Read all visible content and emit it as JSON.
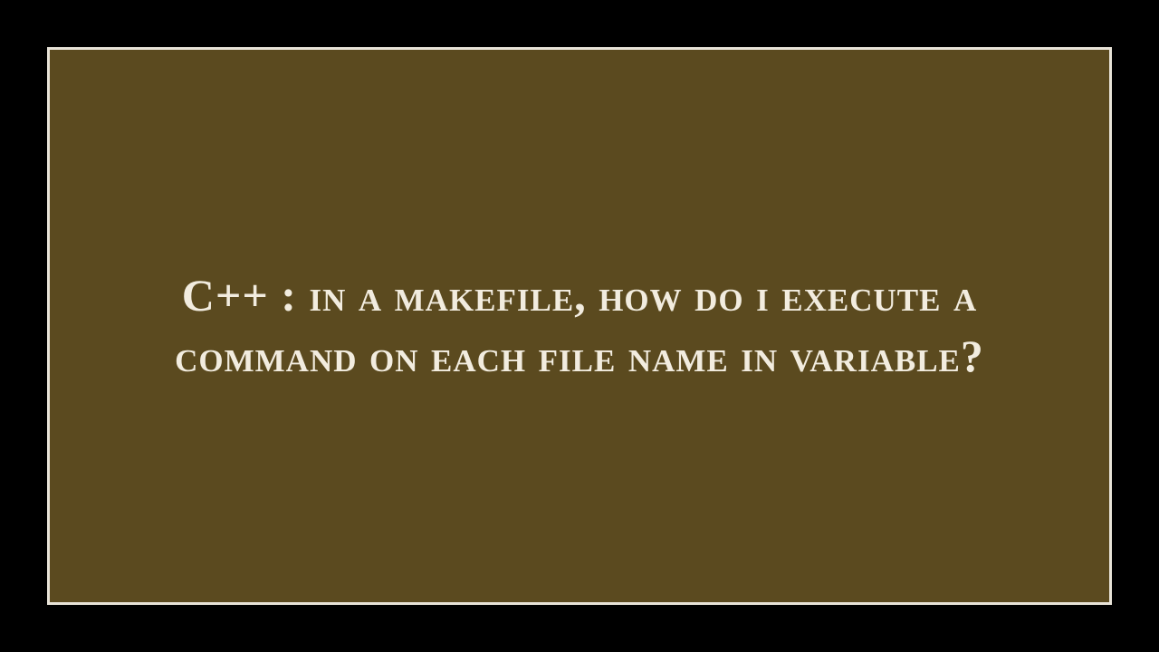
{
  "title": "C++ : In a makefile, how do I execute a command on each file name in variable?"
}
